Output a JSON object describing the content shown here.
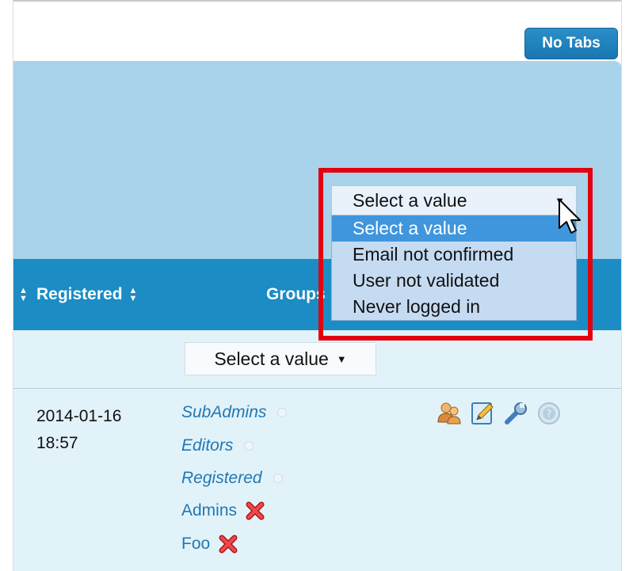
{
  "toolbar": {
    "no_tabs_label": "No Tabs"
  },
  "table": {
    "columns": {
      "registered": "Registered",
      "groups": "Groups"
    },
    "filter": {
      "select_placeholder": "Select a value"
    },
    "row": {
      "registered_date": "2014-01-16",
      "registered_time": "18:57",
      "groups": [
        {
          "name": "SubAdmins",
          "inherited": true
        },
        {
          "name": "Editors",
          "inherited": true
        },
        {
          "name": "Registered",
          "inherited": true
        },
        {
          "name": "Admins",
          "inherited": false
        },
        {
          "name": "Foo",
          "inherited": false
        }
      ]
    }
  },
  "dropdown": {
    "current": "Select a value",
    "options": [
      "Select a value",
      "Email not confirmed",
      "User not validated",
      "Never logged in"
    ],
    "selected_index": 0
  },
  "colors": {
    "header_bg": "#1b8cc4",
    "panel_bg": "#a8d3ea",
    "row_bg": "#e2f2f9",
    "highlight": "#e3000f",
    "link": "#1f78b4"
  }
}
